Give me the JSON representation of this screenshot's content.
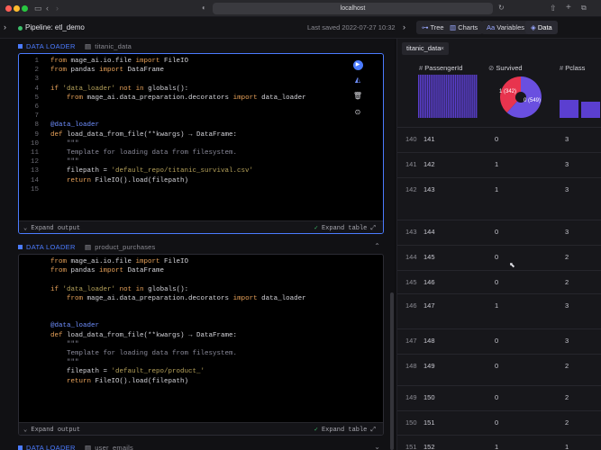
{
  "browser": {
    "url": "localhost"
  },
  "header": {
    "pipeline_title": "Pipeline: etl_demo",
    "last_saved": "Last saved 2022-07-27 10:32",
    "tabs": [
      {
        "label": "Tree",
        "icon": "tree-icon"
      },
      {
        "label": "Charts",
        "icon": "chart-icon"
      },
      {
        "label": "Variables",
        "icon": "variables-icon"
      },
      {
        "label": "Data",
        "icon": "data-icon"
      }
    ]
  },
  "blocks": [
    {
      "type": "DATA LOADER",
      "name": "titanic_data",
      "lines": [
        "from mage_ai.io.file import FileIO",
        "from pandas import DataFrame",
        "",
        "if 'data_loader' not in globals():",
        "    from mage_ai.data_preparation.decorators import data_loader",
        "",
        "",
        "@data_loader",
        "def load_data_from_file(**kwargs) → DataFrame:",
        "    \"\"\"",
        "    Template for loading data from filesystem.",
        "    \"\"\"",
        "    filepath = 'default_repo/titanic_survival.csv'",
        "    return FileIO().load(filepath)",
        ""
      ],
      "line_numbers": [
        "1",
        "2",
        "3",
        "4",
        "5",
        "6",
        "7",
        "8",
        "9",
        "10",
        "11",
        "12",
        "13",
        "14",
        "15"
      ],
      "footer_left": "Expand output",
      "footer_right": "Expand table"
    },
    {
      "type": "DATA LOADER",
      "name": "product_purchases",
      "lines": [
        "from mage_ai.io.file import FileIO",
        "from pandas import DataFrame",
        "",
        "if 'data_loader' not in globals():",
        "    from mage_ai.data_preparation.decorators import data_loader",
        "",
        "",
        "@data_loader",
        "def load_data_from_file(**kwargs) → DataFrame:",
        "    \"\"\"",
        "    Template for loading data from filesystem.",
        "    \"\"\"",
        "    filepath = 'default_repo/product_'",
        "    return FileIO().load(filepath)"
      ],
      "footer_left": "Expand output",
      "footer_right": "Expand table"
    },
    {
      "type": "DATA LOADER",
      "name": "user_emails"
    }
  ],
  "data_panel": {
    "file_tab": "titanic_data",
    "columns": [
      {
        "label": "PassengerId",
        "icon": "hash-icon"
      },
      {
        "label": "Survived",
        "icon": "boolean-icon"
      },
      {
        "label": "Pclass",
        "icon": "hash-icon"
      }
    ],
    "pie_labels": {
      "one": "1 (342)",
      "zero": "0 (549)"
    },
    "survived_counts": {
      "one": 342,
      "zero": 549
    },
    "rows": [
      {
        "index": "140",
        "passenger_id": "141",
        "survived": "0",
        "pclass": "3"
      },
      {
        "index": "141",
        "passenger_id": "142",
        "survived": "1",
        "pclass": "3"
      },
      {
        "index": "142",
        "passenger_id": "143",
        "survived": "1",
        "pclass": "3"
      },
      {
        "index": "143",
        "passenger_id": "144",
        "survived": "0",
        "pclass": "3"
      },
      {
        "index": "144",
        "passenger_id": "145",
        "survived": "0",
        "pclass": "2"
      },
      {
        "index": "145",
        "passenger_id": "146",
        "survived": "0",
        "pclass": "2"
      },
      {
        "index": "146",
        "passenger_id": "147",
        "survived": "1",
        "pclass": "3"
      },
      {
        "index": "147",
        "passenger_id": "148",
        "survived": "0",
        "pclass": "3"
      },
      {
        "index": "148",
        "passenger_id": "149",
        "survived": "0",
        "pclass": "2"
      },
      {
        "index": "149",
        "passenger_id": "150",
        "survived": "0",
        "pclass": "2"
      },
      {
        "index": "150",
        "passenger_id": "151",
        "survived": "0",
        "pclass": "2"
      },
      {
        "index": "151",
        "passenger_id": "152",
        "survived": "1",
        "pclass": "1"
      }
    ]
  },
  "colors": {
    "accent": "#4b7bff",
    "histogram": "#5b3fd0",
    "pie_one": "#e8344e",
    "pie_zero": "#6a4fe0",
    "success": "#3cbf6a"
  }
}
